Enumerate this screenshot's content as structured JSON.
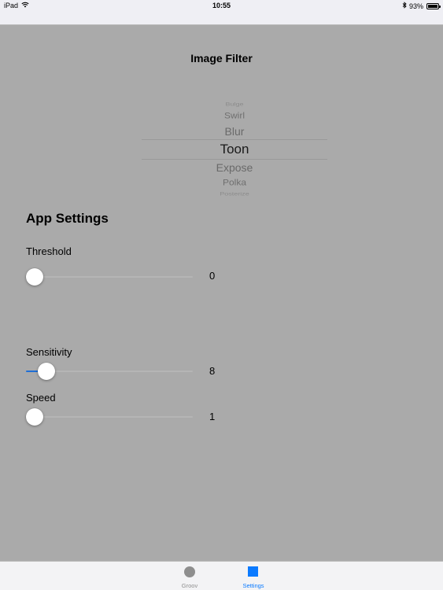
{
  "status_bar": {
    "device": "iPad",
    "time": "10:55",
    "battery_percent": "93%"
  },
  "page_title": "Image Filter",
  "picker": {
    "items": [
      "Bulge",
      "Swirl",
      "Blur",
      "Toon",
      "Expose",
      "Polka",
      "Posterize"
    ],
    "selected": "Toon"
  },
  "app_settings": {
    "heading": "App Settings",
    "threshold": {
      "label": "Threshold",
      "value": "0",
      "fraction": 0.0
    },
    "sensitivity": {
      "label": "Sensitivity",
      "value": "8",
      "fraction": 0.08
    },
    "speed": {
      "label": "Speed",
      "value": "1",
      "fraction": 0.0
    }
  },
  "tab_bar": {
    "tabs": [
      {
        "label": "Groov",
        "icon": "circle-icon",
        "color": "#8e8e8e"
      },
      {
        "label": "Settings",
        "icon": "square-icon",
        "color": "#0a7aff"
      }
    ]
  },
  "colors": {
    "background": "#aaaaaa",
    "accent": "#0a7aff"
  }
}
